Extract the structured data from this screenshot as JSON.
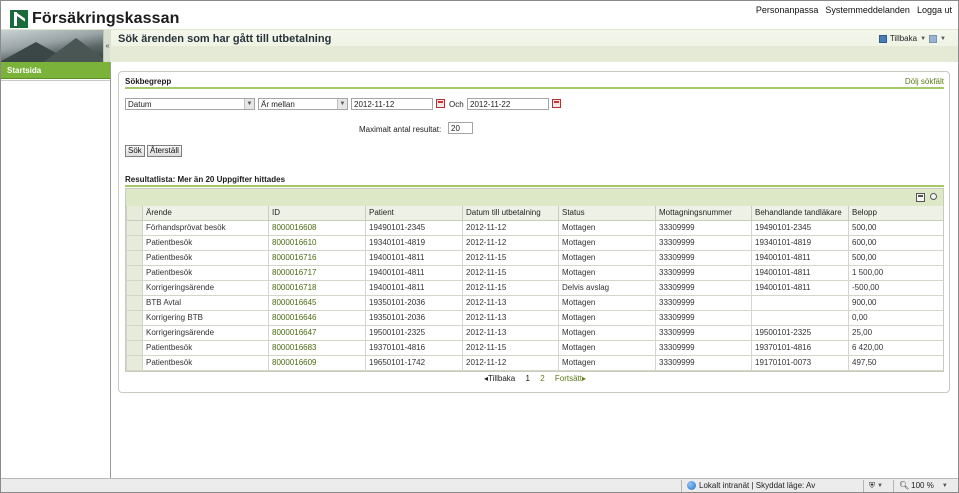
{
  "header": {
    "logo_text": "Försäkringskassan",
    "links": [
      "Personanpassa",
      "Systemmeddelanden",
      "Logga ut"
    ]
  },
  "banner": {
    "toggle_glyph": "«",
    "page_title": "Sök ärenden som har gått till utbetalning",
    "back_label": "Tillbaka"
  },
  "sidebar": {
    "items": [
      {
        "label": "Startsida"
      }
    ]
  },
  "search": {
    "section_title": "Sökbegrepp",
    "hide_link": "Dölj sökfält",
    "field_select": "Datum",
    "operator_select": "Är mellan",
    "date_from": "2012-11-12",
    "and_label": "Och",
    "date_to": "2012-11-22",
    "max_label": "Maximalt antal resultat:",
    "max_value": "20",
    "search_button": "Sök",
    "reset_button": "Återställ"
  },
  "results": {
    "heading": "Resultatlista: Mer än 20 Uppgifter hittades",
    "columns": [
      "Ärende",
      "ID",
      "Patient",
      "Datum till utbetalning",
      "Status",
      "Mottagningsnummer",
      "Behandlande tandläkare",
      "Belopp"
    ],
    "rows": [
      [
        "Förhandsprövat besök",
        "8000016608",
        "19490101-2345",
        "2012-11-12",
        "Mottagen",
        "33309999",
        "19490101-2345",
        "500,00"
      ],
      [
        "Patientbesök",
        "8000016610",
        "19340101-4819",
        "2012-11-12",
        "Mottagen",
        "33309999",
        "19340101-4819",
        "600,00"
      ],
      [
        "Patientbesök",
        "8000016716",
        "19400101-4811",
        "2012-11-15",
        "Mottagen",
        "33309999",
        "19400101-4811",
        "500,00"
      ],
      [
        "Patientbesök",
        "8000016717",
        "19400101-4811",
        "2012-11-15",
        "Mottagen",
        "33309999",
        "19400101-4811",
        "1 500,00"
      ],
      [
        "Korrigeringsärende",
        "8000016718",
        "19400101-4811",
        "2012-11-15",
        "Delvis avslag",
        "33309999",
        "19400101-4811",
        "-500,00"
      ],
      [
        "BTB Avtal",
        "8000016645",
        "19350101-2036",
        "2012-11-13",
        "Mottagen",
        "33309999",
        "",
        "900,00"
      ],
      [
        "Korrigering BTB",
        "8000016646",
        "19350101-2036",
        "2012-11-13",
        "Mottagen",
        "33309999",
        "",
        "0,00"
      ],
      [
        "Korrigeringsärende",
        "8000016647",
        "19500101-2325",
        "2012-11-13",
        "Mottagen",
        "33309999",
        "19500101-2325",
        "25,00"
      ],
      [
        "Patientbesök",
        "8000016683",
        "19370101-4816",
        "2012-11-15",
        "Mottagen",
        "33309999",
        "19370101-4816",
        "6 420,00"
      ],
      [
        "Patientbesök",
        "8000016609",
        "19650101-1742",
        "2012-11-12",
        "Mottagen",
        "33309999",
        "19170101-0073",
        "497,50"
      ]
    ]
  },
  "pager": {
    "prev": "Tillbaka",
    "page1": "1",
    "page2": "2",
    "next": "Fortsätt"
  },
  "statusbar": {
    "zone": "Lokalt intranät | Skyddat läge: Av",
    "zoom": "100 %"
  }
}
